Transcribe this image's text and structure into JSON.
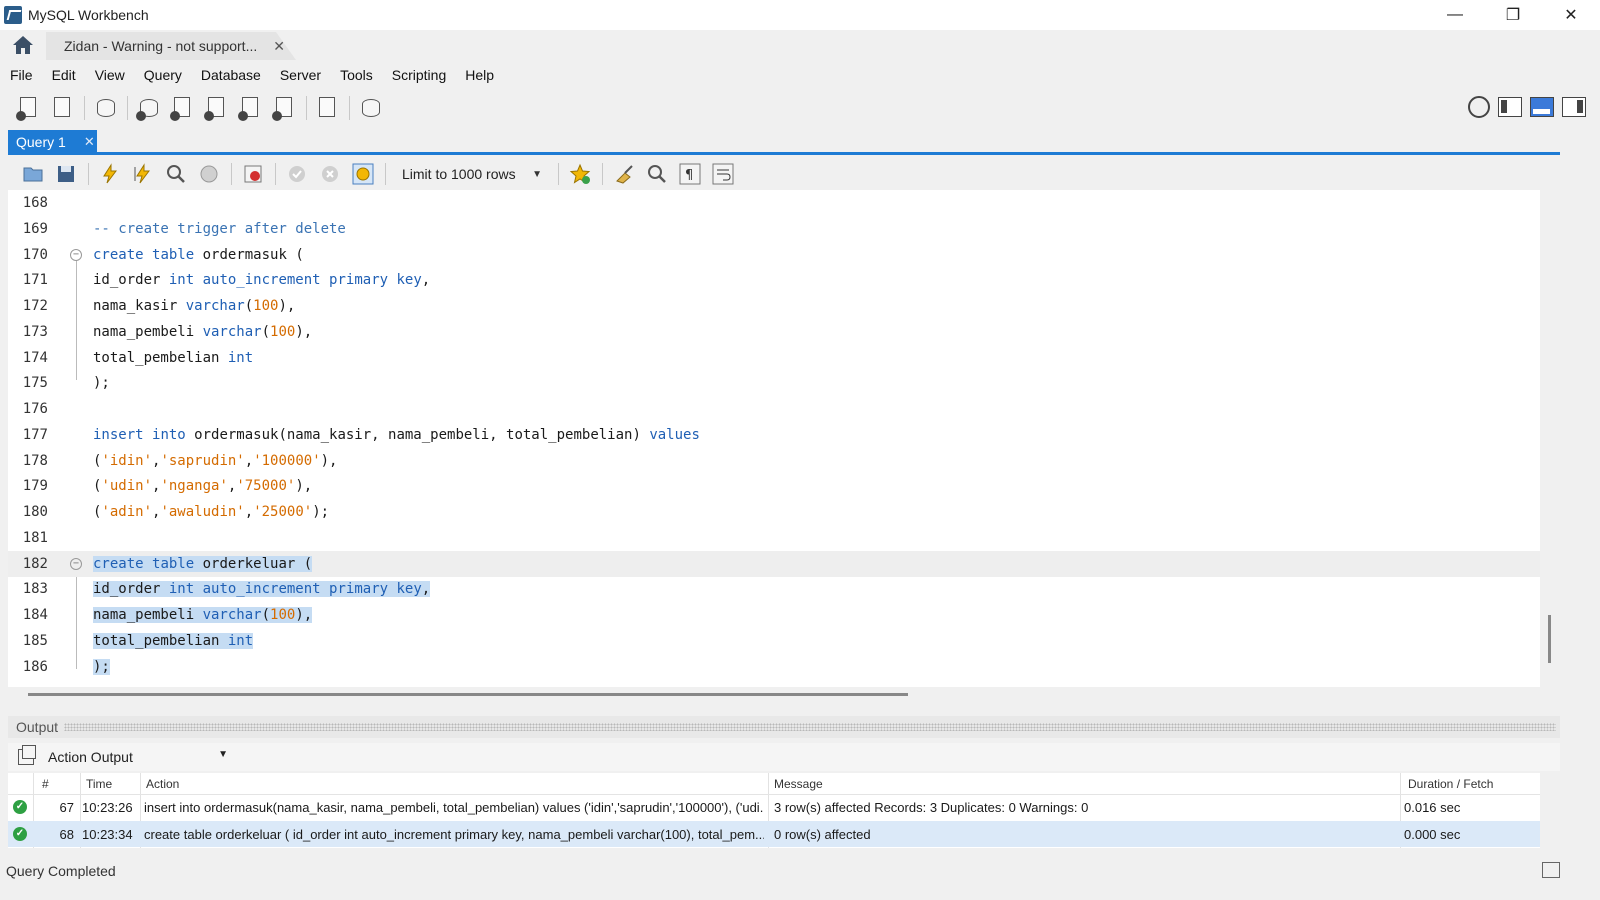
{
  "window": {
    "title": "MySQL Workbench",
    "minimize": "—",
    "restore": "❐",
    "close": "✕"
  },
  "connection_tab": {
    "label": "Zidan - Warning - not support...",
    "close": "✕"
  },
  "menu": [
    "File",
    "Edit",
    "View",
    "Query",
    "Database",
    "Server",
    "Tools",
    "Scripting",
    "Help"
  ],
  "query_tab": {
    "label": "Query 1",
    "close": "✕"
  },
  "sql_toolbar": {
    "limit_select": "Limit to 1000 rows"
  },
  "editor": {
    "lines": [
      {
        "n": "168",
        "t": ""
      },
      {
        "n": "169",
        "t": "-- create trigger after delete"
      },
      {
        "n": "170",
        "t": "create table ordermasuk ("
      },
      {
        "n": "171",
        "t": "id_order int auto_increment primary key,"
      },
      {
        "n": "172",
        "t": "nama_kasir varchar(100),"
      },
      {
        "n": "173",
        "t": "nama_pembeli varchar(100),"
      },
      {
        "n": "174",
        "t": "total_pembelian int"
      },
      {
        "n": "175",
        "t": ");"
      },
      {
        "n": "176",
        "t": ""
      },
      {
        "n": "177",
        "t": "insert into ordermasuk(nama_kasir, nama_pembeli, total_pembelian) values"
      },
      {
        "n": "178",
        "t": "('idin','saprudin','100000'),"
      },
      {
        "n": "179",
        "t": "('udin','nganga','75000'),"
      },
      {
        "n": "180",
        "t": "('adin','awaludin','25000');"
      },
      {
        "n": "181",
        "t": ""
      },
      {
        "n": "182",
        "t": "create table orderkeluar ("
      },
      {
        "n": "183",
        "t": "id_order int auto_increment primary key,"
      },
      {
        "n": "184",
        "t": "nama_pembeli varchar(100),"
      },
      {
        "n": "185",
        "t": "total_pembelian int"
      },
      {
        "n": "186",
        "t": ");"
      }
    ]
  },
  "output": {
    "title": "Output",
    "mode": "Action Output",
    "columns": [
      "#",
      "Time",
      "Action",
      "Message",
      "Duration / Fetch"
    ],
    "rows": [
      {
        "num": "67",
        "time": "10:23:26",
        "action": "insert into ordermasuk(nama_kasir, nama_pembeli, total_pembelian) values ('idin','saprudin','100000'), ('udi...",
        "message": "3 row(s) affected Records: 3  Duplicates: 0  Warnings: 0",
        "duration": "0.016 sec",
        "status": "success"
      },
      {
        "num": "68",
        "time": "10:23:34",
        "action": "create table orderkeluar ( id_order int auto_increment primary key, nama_pembeli varchar(100), total_pem...",
        "message": "0 row(s) affected",
        "duration": "0.000 sec",
        "status": "success"
      }
    ]
  },
  "status": {
    "text": "Query Completed"
  },
  "colors": {
    "accent": "#1e7bd4",
    "keyword": "#1f5fb4",
    "string": "#d46b00",
    "selection": "#c5dcf3",
    "success": "#2ea043"
  }
}
